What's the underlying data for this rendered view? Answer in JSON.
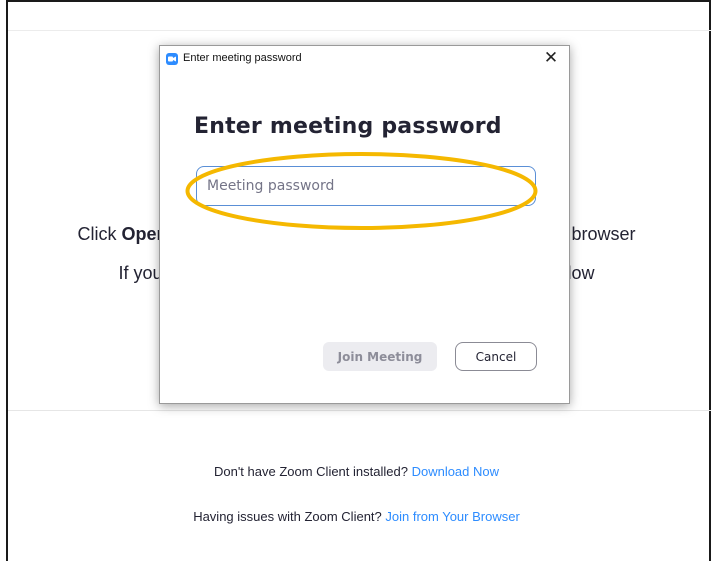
{
  "background_page": {
    "line1_prefix": "Click ",
    "line1_bold": "Open",
    "line1_suffix": "r browser",
    "line2_prefix": "If you",
    "line2_suffix": "elow",
    "footer_install_text": "Don't have Zoom Client installed?",
    "footer_install_link": "Download Now",
    "footer_issue_text": "Having issues with Zoom Client?",
    "footer_issue_link": "Join from Your Browser",
    "link_color": "#2d8cff"
  },
  "dialog": {
    "window_title": "Enter meeting password",
    "close_glyph": "✕",
    "heading": "Enter meeting password",
    "password_input": {
      "placeholder": "Meeting password",
      "value": ""
    },
    "join_button_label": "Join Meeting",
    "cancel_button_label": "Cancel",
    "app_icon": "zoom-camera-icon",
    "accent_color": "#2d8cff"
  },
  "annotation": {
    "highlight_color": "#f5b800",
    "shape": "ellipse"
  }
}
